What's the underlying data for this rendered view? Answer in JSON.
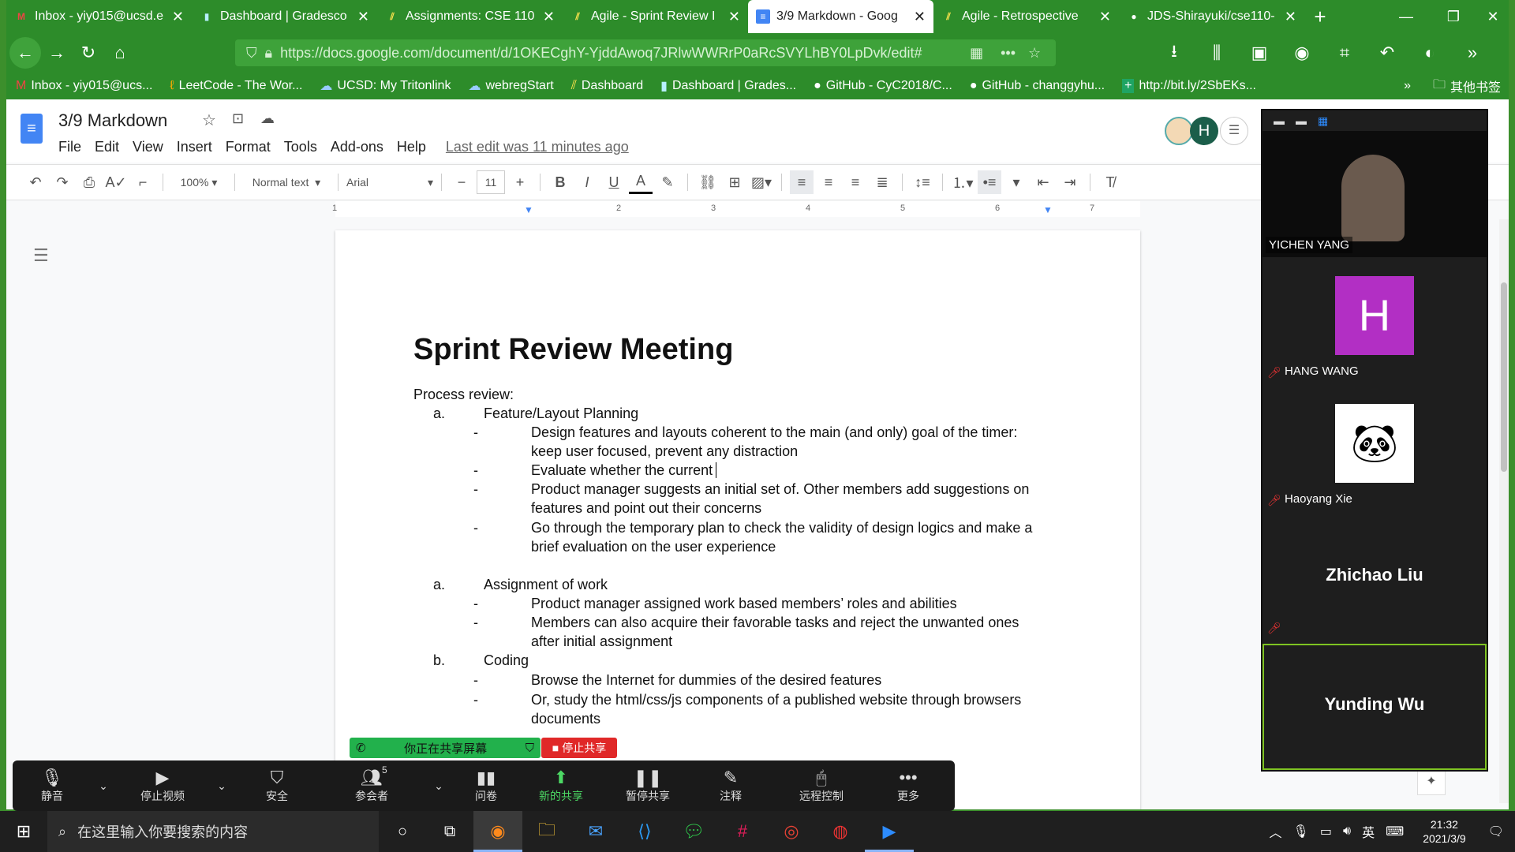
{
  "browser": {
    "tabs": [
      {
        "label": "Inbox - yiy015@ucsd.e",
        "icon": "gmail-icon",
        "active": false
      },
      {
        "label": "Dashboard | Gradesco",
        "icon": "chart-icon",
        "active": false
      },
      {
        "label": "Assignments: CSE 110",
        "icon": "canvas-icon",
        "active": false
      },
      {
        "label": "Agile - Sprint Review I",
        "icon": "canvas-icon",
        "active": false
      },
      {
        "label": "3/9 Markdown - Goog",
        "icon": "docs-icon",
        "active": true
      },
      {
        "label": "Agile - Retrospective",
        "icon": "canvas-icon",
        "active": false
      },
      {
        "label": "JDS-Shirayuki/cse110-",
        "icon": "github-icon",
        "active": false
      }
    ],
    "url": "https://docs.google.com/document/d/1OKECghY-YjddAwoq7JRlwWWRrP0aRcSVYLhBY0LpDvk/edit#",
    "bookmarks": [
      {
        "label": "Inbox - yiy015@ucs...",
        "icon": "gmail-icon"
      },
      {
        "label": "LeetCode - The Wor...",
        "icon": "leetcode-icon"
      },
      {
        "label": "UCSD: My Tritonlink",
        "icon": "ucsd-icon"
      },
      {
        "label": "webregStart",
        "icon": "ucsd-icon"
      },
      {
        "label": "Dashboard",
        "icon": "canvas-icon"
      },
      {
        "label": "Dashboard | Grades...",
        "icon": "chart-icon"
      },
      {
        "label": "GitHub - CyC2018/C...",
        "icon": "github-icon"
      },
      {
        "label": "GitHub - changgyhu...",
        "icon": "github-icon"
      },
      {
        "label": "http://bit.ly/2SbEKs...",
        "icon": "plus-icon"
      }
    ],
    "other_bookmarks": "其他书签"
  },
  "docs": {
    "title": "3/9 Markdown",
    "menu": [
      "File",
      "Edit",
      "View",
      "Insert",
      "Format",
      "Tools",
      "Add-ons",
      "Help"
    ],
    "last_edit": "Last edit was 11 minutes ago",
    "toolbar": {
      "zoom": "100%",
      "style": "Normal text",
      "font": "Arial",
      "size": "11"
    },
    "ruler": [
      "1",
      "2",
      "3",
      "4",
      "5",
      "6",
      "7"
    ],
    "document": {
      "heading": "Sprint Review Meeting",
      "intro": "Process review:",
      "lines": [
        {
          "marker": "a.",
          "text": "Feature/Layout Planning",
          "level": 1
        },
        {
          "marker": "-",
          "text": "Design features and layouts coherent to the main (and only) goal of the timer:",
          "level": 2
        },
        {
          "marker": "",
          "text": "keep user focused, prevent any distraction",
          "level": 2
        },
        {
          "marker": "-",
          "text": "Evaluate whether the current",
          "level": 2
        },
        {
          "marker": "-",
          "text": "Product manager suggests an initial set of. Other members add suggestions on",
          "level": 2
        },
        {
          "marker": "",
          "text": "features and point out their concerns",
          "level": 2
        },
        {
          "marker": "-",
          "text": "Go through the temporary plan to check the validity of design logics and make a",
          "level": 2
        },
        {
          "marker": "",
          "text": "brief evaluation on the user experience",
          "level": 2
        },
        {
          "marker": "a.",
          "text": "Assignment of work",
          "level": 1
        },
        {
          "marker": "-",
          "text": "Product manager assigned work based members’ roles and abilities",
          "level": 2
        },
        {
          "marker": "-",
          "text": "Members can also acquire their favorable tasks and reject the unwanted ones",
          "level": 2
        },
        {
          "marker": "",
          "text": "after initial assignment",
          "level": 2
        },
        {
          "marker": "b.",
          "text": "Coding",
          "level": 1
        },
        {
          "marker": "-",
          "text": "Browse the Internet for dummies of the desired features",
          "level": 2
        },
        {
          "marker": "-",
          "text": "Or, study the html/css/js components of a published website through browsers",
          "level": 2
        },
        {
          "marker": "",
          "text": "documents",
          "level": 2
        }
      ]
    }
  },
  "zoom": {
    "participants": [
      {
        "name": "YICHEN YANG",
        "type": "video"
      },
      {
        "name": "HANG WANG",
        "type": "avatar",
        "initial": "H",
        "muted": true
      },
      {
        "name": "Haoyang Xie",
        "type": "panda",
        "muted": true
      },
      {
        "name": "Zhichao Liu",
        "type": "name",
        "muted": true
      },
      {
        "name": "Yunding Wu",
        "type": "name",
        "active": true
      }
    ],
    "share_banner": "你正在共享屏幕",
    "stop_share": "停止共享",
    "participants_count": "5",
    "controls": [
      {
        "label": "静音",
        "icon": "microphone-icon"
      },
      {
        "label": "停止视频",
        "icon": "video-icon"
      },
      {
        "label": "安全",
        "icon": "shield-icon"
      },
      {
        "label": "参会者",
        "icon": "participants-icon"
      },
      {
        "label": "问卷",
        "icon": "poll-icon"
      },
      {
        "label": "新的共享",
        "icon": "share-icon"
      },
      {
        "label": "暂停共享",
        "icon": "pause-icon"
      },
      {
        "label": "注释",
        "icon": "pen-icon"
      },
      {
        "label": "远程控制",
        "icon": "mouse-icon"
      },
      {
        "label": "更多",
        "icon": "more-icon"
      }
    ]
  },
  "taskbar": {
    "search_placeholder": "在这里输入你要搜索的内容",
    "time": "21:32",
    "date": "2021/3/9",
    "ime": "英"
  }
}
